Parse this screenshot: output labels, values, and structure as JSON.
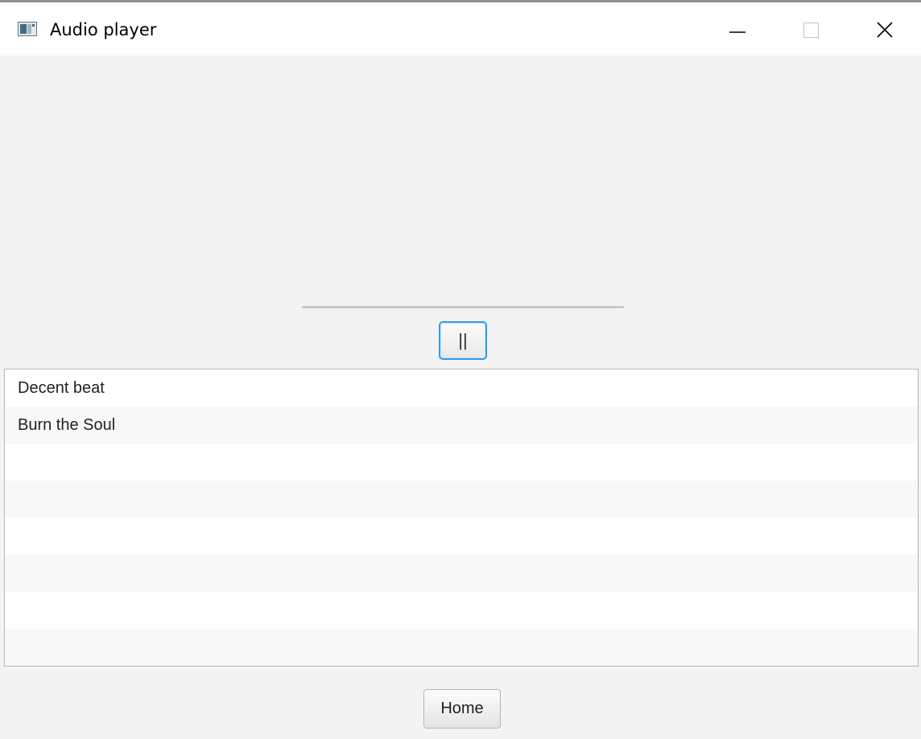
{
  "window": {
    "title": "Audio player",
    "icon": "app-window-icon",
    "controls": {
      "minimize": "minimize-icon",
      "maximize": "maximize-icon",
      "close": "close-icon"
    }
  },
  "player": {
    "progress_fraction": 0,
    "pause_label": "||"
  },
  "playlist": {
    "items": [
      {
        "title": "Decent beat"
      },
      {
        "title": "Burn the Soul"
      }
    ],
    "empty_rows": 6
  },
  "footer": {
    "home_label": "Home"
  },
  "colors": {
    "window_bg": "#f3f3f3",
    "focus_accent": "#2d9be8",
    "list_alt_row": "#f8f8f8"
  }
}
